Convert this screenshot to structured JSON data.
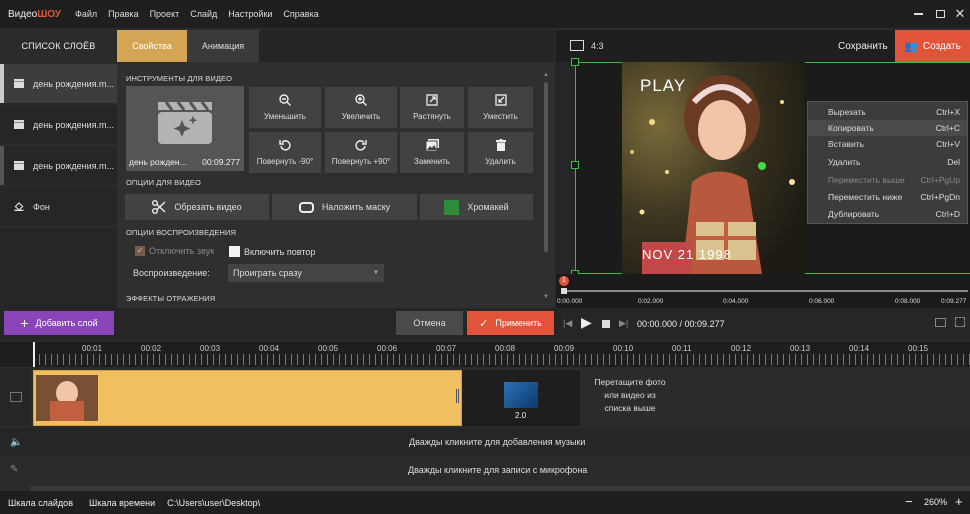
{
  "app": {
    "logo_part1": "Видео",
    "logo_part2": "ШОУ"
  },
  "menu": [
    "Файл",
    "Правка",
    "Проект",
    "Слайд",
    "Настройки",
    "Справка"
  ],
  "layers_panel": {
    "title": "СПИСОК СЛОЁВ",
    "items": [
      {
        "label": "день рождения.m..."
      },
      {
        "label": "день рождения.m..."
      },
      {
        "label": "день рождения.m..."
      },
      {
        "label": "Фон"
      }
    ],
    "add_layer": "Добавить слой"
  },
  "tabs": {
    "properties": "Свойства",
    "animation": "Анимация"
  },
  "video_tools": {
    "title": "ИНСТРУМЕНТЫ ДЛЯ ВИДЕО",
    "clip_name": "день рожден...",
    "clip_duration": "00:09.277",
    "buttons": [
      "Уменьшить",
      "Увеличить",
      "Растянуть",
      "Уместить",
      "Повернуть -90°",
      "Повернуть +90°",
      "Заменить",
      "Удалить"
    ]
  },
  "video_options": {
    "title": "ОПЦИИ ДЛЯ ВИДЕО",
    "crop": "Обрезать видео",
    "mask": "Наложить маску",
    "chroma": "Хромакей"
  },
  "playback_options": {
    "title": "ОПЦИИ ВОСПРОИЗВЕДЕНИЯ",
    "mute": "Отключить звук",
    "loop": "Включить повтор",
    "playback_label": "Воспроизведение:",
    "playback_value": "Проиграть сразу"
  },
  "reflection": {
    "title": "ЭФФЕКТЫ ОТРАЖЕНИЯ"
  },
  "preview": {
    "ratio": "4:3",
    "save": "Сохранить",
    "create": "Создать",
    "overlay_play": "PLAY",
    "overlay_date": "NOV 21 1998",
    "scrub_times": [
      "0:00.000",
      "0:02.000",
      "0:04.000",
      "0:06.000",
      "0:08.000",
      "0:09.277"
    ],
    "marker": "1"
  },
  "context_menu": [
    {
      "label": "Вырезать",
      "shortcut": "Ctrl+X",
      "disabled": false
    },
    {
      "label": "Копировать",
      "shortcut": "Ctrl+C",
      "disabled": false
    },
    {
      "label": "Вставить",
      "shortcut": "Ctrl+V",
      "disabled": false
    },
    {
      "label": "Удалить",
      "shortcut": "Del",
      "disabled": false
    },
    {
      "label": "Переместить выше",
      "shortcut": "Ctrl+PgUp",
      "disabled": true
    },
    {
      "label": "Переместить ниже",
      "shortcut": "Ctrl+PgDn",
      "disabled": false
    },
    {
      "label": "Дублировать",
      "shortcut": "Ctrl+D",
      "disabled": false
    }
  ],
  "actions": {
    "cancel": "Отмена",
    "apply": "Применить",
    "time": "00:00.000 / 00:09.277"
  },
  "timeline": {
    "ticks": [
      "00:01",
      "00:02",
      "00:03",
      "00:04",
      "00:05",
      "00:06",
      "00:07",
      "00:08",
      "00:09",
      "00:10",
      "00:11",
      "00:12",
      "00:13",
      "00:14",
      "00:15"
    ],
    "transition_duration": "2.0",
    "drop_hint": "Перетащите фото или видео из списка выше",
    "music_hint": "Дважды кликните для добавления музыки",
    "mic_hint": "Дважды кликните для записи с микрофона"
  },
  "statusbar": {
    "slides_tab": "Шкала слайдов",
    "timeline_tab": "Шкала времени",
    "path": "C:\\Users\\user\\Desktop\\",
    "zoom": "260%"
  },
  "colors": {
    "accent_orange": "#d5a556",
    "create_red": "#e2543a",
    "chroma_green": "#2e8b3c",
    "add_layer_purple": "#8a45b8"
  }
}
